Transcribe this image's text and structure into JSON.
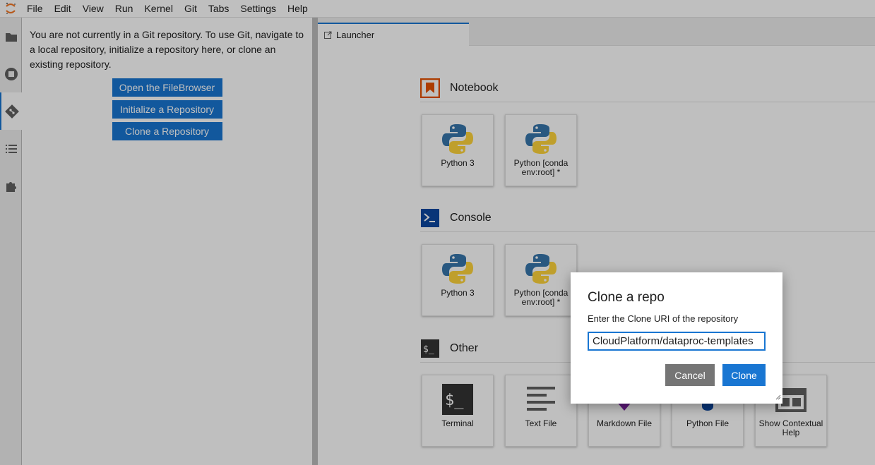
{
  "menubar": {
    "items": [
      "File",
      "Edit",
      "View",
      "Run",
      "Kernel",
      "Git",
      "Tabs",
      "Settings",
      "Help"
    ]
  },
  "activitybar": {
    "icons": [
      "folder-icon",
      "running-icon",
      "git-icon",
      "toc-icon",
      "extension-icon"
    ]
  },
  "git_panel": {
    "message": "You are not currently in a Git repository. To use Git, navigate to a local repository, initialize a repository here, or clone an existing repository.",
    "open_filebrowser": "Open the FileBrowser",
    "initialize": "Initialize a Repository",
    "clone": "Clone a Repository"
  },
  "tabs": [
    {
      "label": "Launcher"
    }
  ],
  "launcher": {
    "notebook": {
      "title": "Notebook",
      "cards": [
        {
          "label": "Python 3"
        },
        {
          "label": "Python [conda env:root] *"
        }
      ]
    },
    "console": {
      "title": "Console",
      "cards": [
        {
          "label": "Python 3"
        },
        {
          "label": "Python [conda env:root] *"
        }
      ]
    },
    "other": {
      "title": "Other",
      "cards": [
        {
          "label": "Terminal"
        },
        {
          "label": "Text File"
        },
        {
          "label": "Markdown File"
        },
        {
          "label": "Python File"
        },
        {
          "label": "Show Contextual Help"
        }
      ]
    }
  },
  "dialog": {
    "title": "Clone a repo",
    "prompt": "Enter the Clone URI of the repository",
    "input_value": "CloudPlatform/dataproc-templates",
    "cancel": "Cancel",
    "clone": "Clone"
  },
  "colors": {
    "accent": "#1976d2",
    "notebook_icon": "#e65100",
    "console_icon": "#0d47a1",
    "other_icon": "#333333"
  }
}
